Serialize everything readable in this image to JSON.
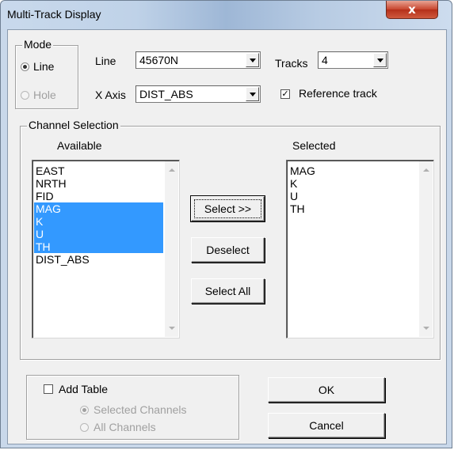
{
  "window": {
    "title": "Multi-Track Display",
    "close_label": "x"
  },
  "mode": {
    "group_title": "Mode",
    "options": [
      {
        "label": "Line",
        "checked": true,
        "enabled": true
      },
      {
        "label": "Hole",
        "checked": false,
        "enabled": false
      }
    ]
  },
  "line": {
    "label": "Line",
    "value": "45670N"
  },
  "xaxis": {
    "label": "X Axis",
    "value": "DIST_ABS"
  },
  "tracks": {
    "label": "Tracks",
    "value": "4"
  },
  "reference_track": {
    "label": "Reference track",
    "checked": true
  },
  "channel_selection": {
    "group_title": "Channel Selection",
    "available_header": "Available",
    "selected_header": "Selected",
    "available": [
      {
        "label": "EAST",
        "selected": false
      },
      {
        "label": "NRTH",
        "selected": false
      },
      {
        "label": "FID",
        "selected": false
      },
      {
        "label": "MAG",
        "selected": true
      },
      {
        "label": "K",
        "selected": true
      },
      {
        "label": "U",
        "selected": true
      },
      {
        "label": "TH",
        "selected": true
      },
      {
        "label": "DIST_ABS",
        "selected": false
      }
    ],
    "selected": [
      "MAG",
      "K",
      "U",
      "TH"
    ],
    "buttons": {
      "select": "Select >>",
      "deselect": "Deselect",
      "select_all": "Select All"
    }
  },
  "add_table": {
    "label": "Add Table",
    "checked": false,
    "options": [
      {
        "label": "Selected Channels",
        "checked": true,
        "enabled": false
      },
      {
        "label": "All Channels",
        "checked": false,
        "enabled": false
      }
    ]
  },
  "actions": {
    "ok": "OK",
    "cancel": "Cancel"
  },
  "colors": {
    "selection": "#3399ff",
    "dialog_bg": "#f0f0f0",
    "close_button": "#c7452d"
  }
}
